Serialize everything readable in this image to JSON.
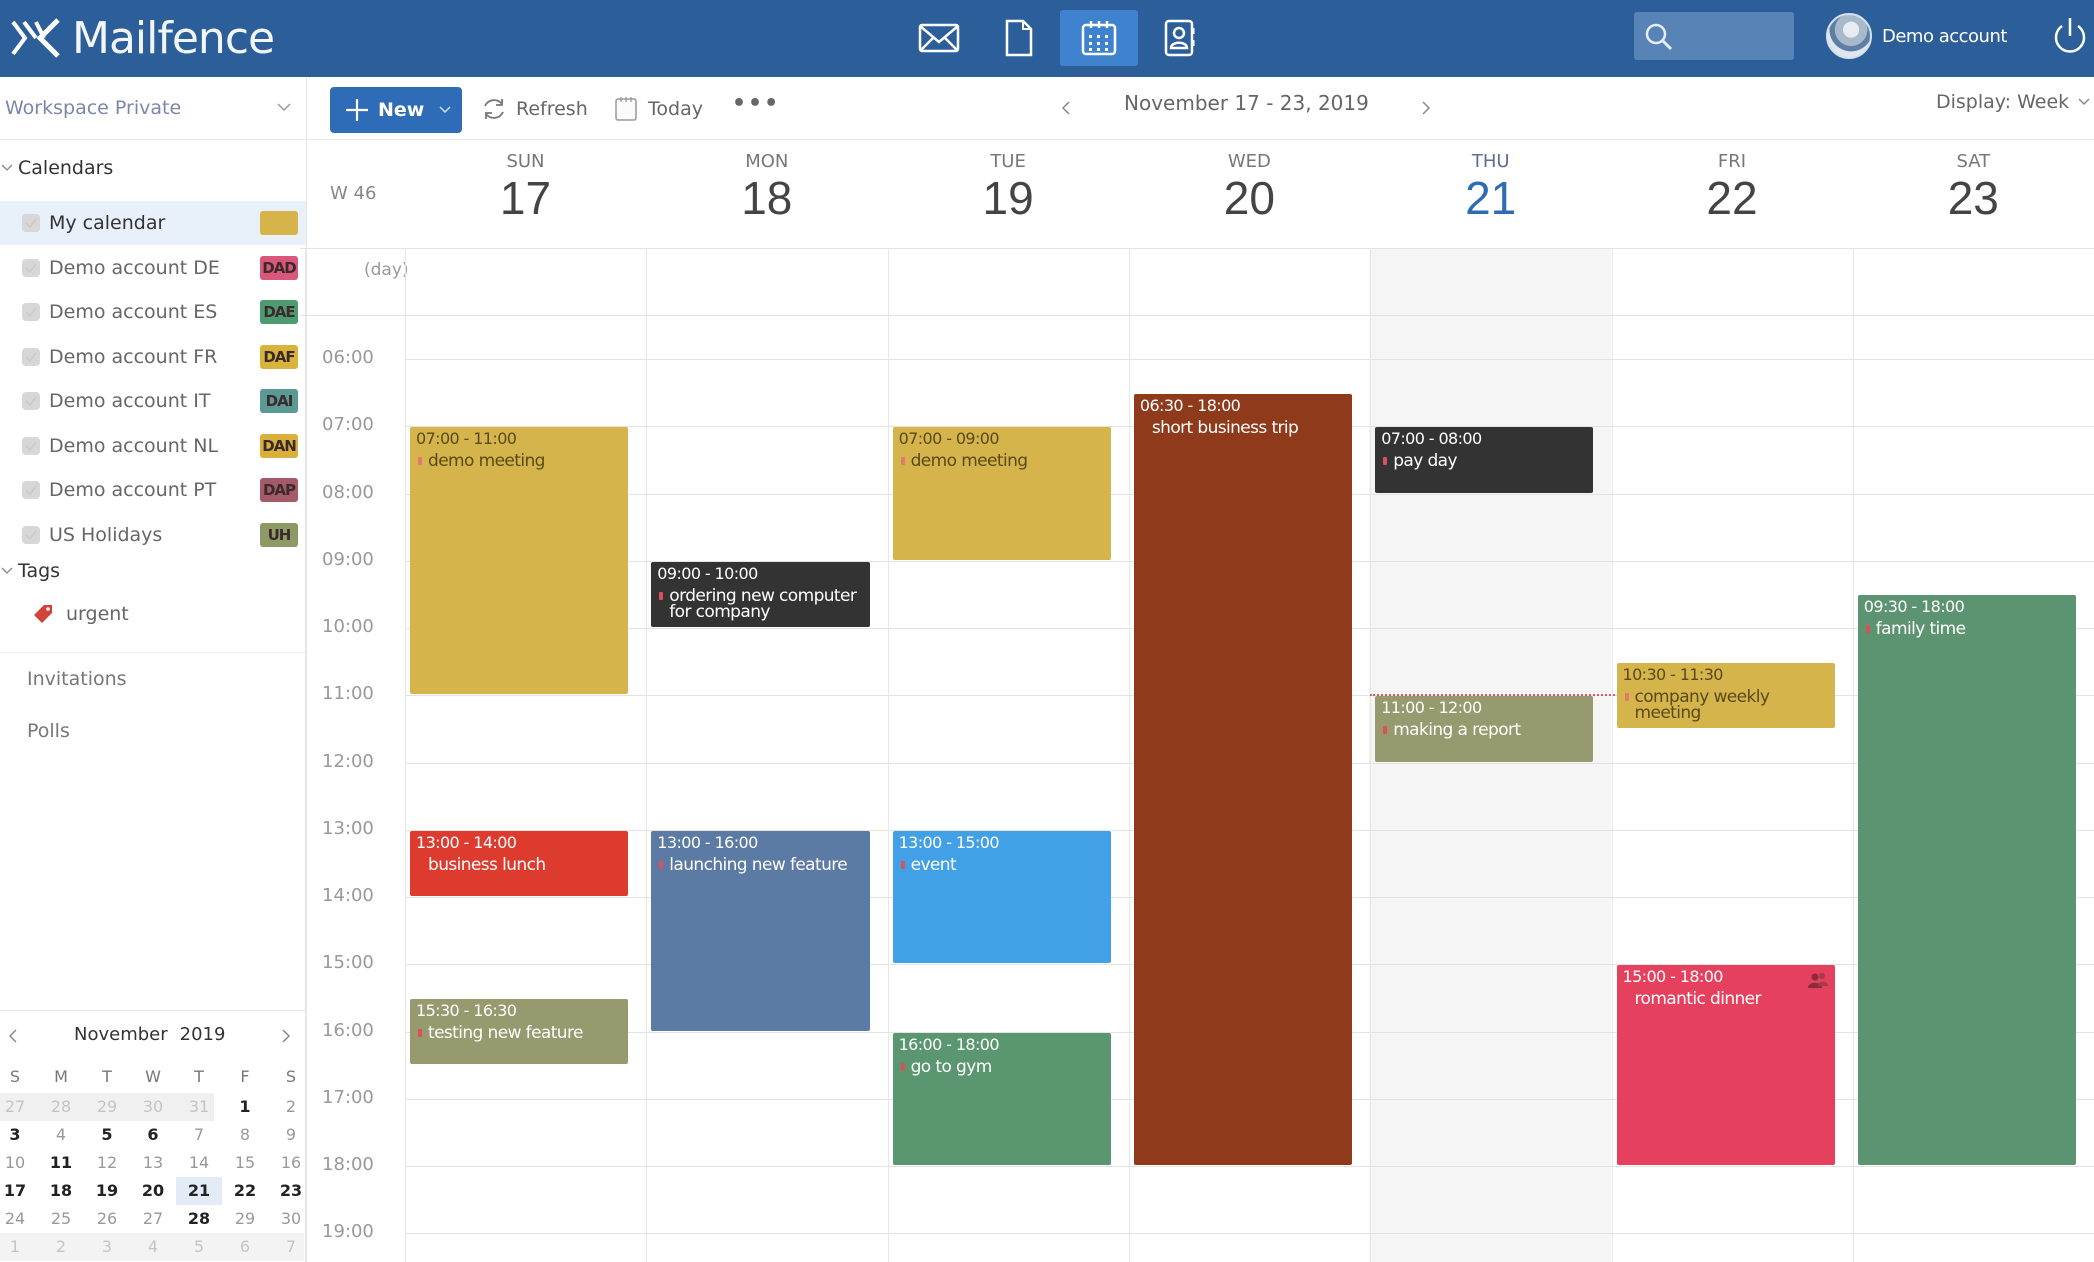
{
  "header": {
    "brand": "Mailfence",
    "apps": [
      {
        "name": "mail",
        "icon": "envelope-icon",
        "active": false
      },
      {
        "name": "documents",
        "icon": "document-icon",
        "active": false
      },
      {
        "name": "calendar",
        "icon": "calendar-icon",
        "active": true
      },
      {
        "name": "contacts",
        "icon": "contacts-icon",
        "active": false
      }
    ],
    "search_placeholder": "",
    "account_name": "Demo account",
    "colors": {
      "bar": "#2c5f9a",
      "active_app": "#3f83cf"
    }
  },
  "sidebar": {
    "workspace": "Workspace Private",
    "calendars_heading": "Calendars",
    "calendars": [
      {
        "name": "My calendar",
        "badge": "",
        "color": "#d6b44a",
        "selected": true
      },
      {
        "name": "Demo account DE",
        "badge": "DAD",
        "color": "#d9577a"
      },
      {
        "name": "Demo account ES",
        "badge": "DAE",
        "color": "#4e9a73"
      },
      {
        "name": "Demo account FR",
        "badge": "DAF",
        "color": "#d9b43c"
      },
      {
        "name": "Demo account IT",
        "badge": "DAI",
        "color": "#5b9a94"
      },
      {
        "name": "Demo account NL",
        "badge": "DAN",
        "color": "#d8b03b"
      },
      {
        "name": "Demo account PT",
        "badge": "DAP",
        "color": "#a45a68"
      },
      {
        "name": "US Holidays",
        "badge": "UH",
        "color": "#8d9a66"
      }
    ],
    "tags_heading": "Tags",
    "tags": [
      {
        "name": "urgent",
        "color": "#d2433a"
      }
    ],
    "links": [
      "Invitations",
      "Polls"
    ],
    "mini_calendar": {
      "month": "November",
      "year": "2019",
      "dow": [
        "S",
        "M",
        "T",
        "W",
        "T",
        "F",
        "S"
      ],
      "weeks": [
        [
          {
            "d": "27",
            "s": "muted"
          },
          {
            "d": "28",
            "s": "muted"
          },
          {
            "d": "29",
            "s": "muted"
          },
          {
            "d": "30",
            "s": "muted"
          },
          {
            "d": "31",
            "s": "muted"
          },
          {
            "d": "1",
            "s": "bold"
          },
          {
            "d": "2",
            "s": ""
          }
        ],
        [
          {
            "d": "3",
            "s": "bold"
          },
          {
            "d": "4",
            "s": ""
          },
          {
            "d": "5",
            "s": "bold"
          },
          {
            "d": "6",
            "s": "bold"
          },
          {
            "d": "7",
            "s": ""
          },
          {
            "d": "8",
            "s": ""
          },
          {
            "d": "9",
            "s": ""
          }
        ],
        [
          {
            "d": "10",
            "s": ""
          },
          {
            "d": "11",
            "s": "bold"
          },
          {
            "d": "12",
            "s": ""
          },
          {
            "d": "13",
            "s": ""
          },
          {
            "d": "14",
            "s": ""
          },
          {
            "d": "15",
            "s": ""
          },
          {
            "d": "16",
            "s": ""
          }
        ],
        [
          {
            "d": "17",
            "s": "bold"
          },
          {
            "d": "18",
            "s": "bold"
          },
          {
            "d": "19",
            "s": "bold"
          },
          {
            "d": "20",
            "s": "bold"
          },
          {
            "d": "21",
            "s": "bold today"
          },
          {
            "d": "22",
            "s": "bold"
          },
          {
            "d": "23",
            "s": "bold"
          }
        ],
        [
          {
            "d": "24",
            "s": ""
          },
          {
            "d": "25",
            "s": ""
          },
          {
            "d": "26",
            "s": ""
          },
          {
            "d": "27",
            "s": ""
          },
          {
            "d": "28",
            "s": "bold"
          },
          {
            "d": "29",
            "s": ""
          },
          {
            "d": "30",
            "s": ""
          }
        ],
        [
          {
            "d": "1",
            "s": "muted"
          },
          {
            "d": "2",
            "s": "muted"
          },
          {
            "d": "3",
            "s": "muted"
          },
          {
            "d": "4",
            "s": "muted"
          },
          {
            "d": "5",
            "s": "muted"
          },
          {
            "d": "6",
            "s": "muted"
          },
          {
            "d": "7",
            "s": "muted"
          }
        ]
      ]
    }
  },
  "toolbar": {
    "new_label": "New",
    "refresh_label": "Refresh",
    "today_label": "Today",
    "more_label": "•••",
    "range_label": "November 17 - 23, 2019",
    "display_label": "Display: Week"
  },
  "week": {
    "week_label": "W 46",
    "allday_label": "(day)",
    "days": [
      {
        "dow": "SUN",
        "date": "17",
        "today": false
      },
      {
        "dow": "MON",
        "date": "18",
        "today": false
      },
      {
        "dow": "TUE",
        "date": "19",
        "today": false
      },
      {
        "dow": "WED",
        "date": "20",
        "today": false
      },
      {
        "dow": "THU",
        "date": "21",
        "today": true
      },
      {
        "dow": "FRI",
        "date": "22",
        "today": false
      },
      {
        "dow": "SAT",
        "date": "23",
        "today": false
      }
    ],
    "hours": [
      "06:00",
      "07:00",
      "08:00",
      "09:00",
      "10:00",
      "11:00",
      "12:00",
      "13:00",
      "14:00",
      "15:00",
      "16:00",
      "17:00",
      "18:00",
      "19:00"
    ],
    "now_time": "11:00",
    "events": [
      {
        "day": 0,
        "start": "07:00",
        "end": "11:00",
        "time": "07:00 - 11:00",
        "title": "demo meeting",
        "bg": "#d4b44b",
        "fg": "#5a4a18",
        "mark": "#e07a6a"
      },
      {
        "day": 0,
        "start": "13:00",
        "end": "14:00",
        "time": "13:00 - 14:00",
        "title": "business lunch",
        "bg": "#dd3b2e",
        "fg": "#ffffff",
        "mark": "transparent"
      },
      {
        "day": 0,
        "start": "15:30",
        "end": "16:30",
        "time": "15:30 - 16:30",
        "title": "testing new feature",
        "bg": "#979a6e",
        "fg": "#ffffff",
        "mark": "#d8505a"
      },
      {
        "day": 1,
        "start": "09:00",
        "end": "10:00",
        "time": "09:00 - 10:00",
        "title": "ordering new computer for company",
        "bg": "#333333",
        "fg": "#ffffff",
        "mark": "#d8505a"
      },
      {
        "day": 1,
        "start": "13:00",
        "end": "16:00",
        "time": "13:00 - 16:00",
        "title": "launching new feature",
        "bg": "#5b7aa4",
        "fg": "#ffffff",
        "mark": "#d8505a"
      },
      {
        "day": 2,
        "start": "07:00",
        "end": "09:00",
        "time": "07:00 - 09:00",
        "title": "demo meeting",
        "bg": "#d4b44b",
        "fg": "#5a4a18",
        "mark": "#e07a6a"
      },
      {
        "day": 2,
        "start": "13:00",
        "end": "15:00",
        "time": "13:00 - 15:00",
        "title": "event",
        "bg": "#42a0e6",
        "fg": "#ffffff",
        "mark": "#d8505a"
      },
      {
        "day": 2,
        "start": "16:00",
        "end": "18:00",
        "time": "16:00 - 18:00",
        "title": "go to gym",
        "bg": "#5a9670",
        "fg": "#ffffff",
        "mark": "#d8505a"
      },
      {
        "day": 3,
        "start": "06:30",
        "end": "18:00",
        "time": "06:30 - 18:00",
        "title": "short business trip",
        "bg": "#8f3a1b",
        "fg": "#ffffff",
        "mark": "transparent"
      },
      {
        "day": 4,
        "start": "07:00",
        "end": "08:00",
        "time": "07:00 - 08:00",
        "title": "pay day",
        "bg": "#333333",
        "fg": "#ffffff",
        "mark": "#d8505a"
      },
      {
        "day": 4,
        "start": "11:00",
        "end": "12:00",
        "time": "11:00 - 12:00",
        "title": "making a report",
        "bg": "#979a6e",
        "fg": "#ffffff",
        "mark": "#d8505a"
      },
      {
        "day": 5,
        "start": "10:30",
        "end": "11:30",
        "time": "10:30 - 11:30",
        "title": "company weekly meeting",
        "bg": "#d4b44b",
        "fg": "#5a4a18",
        "mark": "#e07a6a"
      },
      {
        "day": 5,
        "start": "15:00",
        "end": "18:00",
        "time": "15:00 - 18:00",
        "title": "romantic dinner",
        "bg": "#e5405e",
        "fg": "#ffffff",
        "mark": "transparent",
        "icon": "attendees-icon"
      },
      {
        "day": 6,
        "start": "09:30",
        "end": "18:00",
        "time": "09:30 - 18:00",
        "title": "family time",
        "bg": "#5c9472",
        "fg": "#ffffff",
        "mark": "#d8505a"
      }
    ]
  }
}
